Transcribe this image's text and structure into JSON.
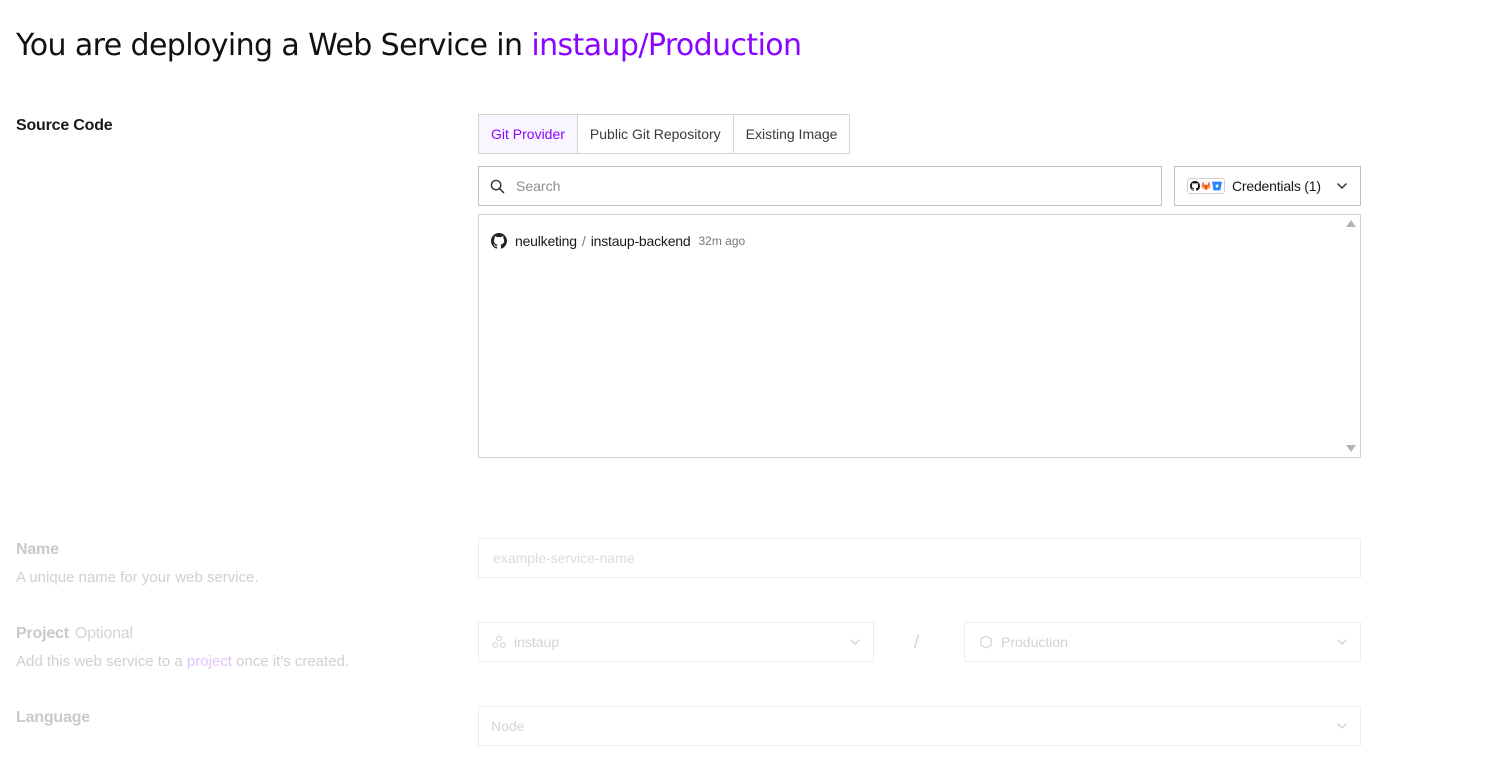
{
  "header": {
    "title_prefix": "You are deploying a Web Service in ",
    "title_workspace": "instaup/Production",
    "accent_color": "#8a05ff"
  },
  "source_code": {
    "label": "Source Code",
    "tabs": [
      {
        "label": "Git Provider",
        "active": true
      },
      {
        "label": "Public Git Repository",
        "active": false
      },
      {
        "label": "Existing Image",
        "active": false
      }
    ],
    "search": {
      "placeholder": "Search",
      "value": ""
    },
    "credentials": {
      "label": "Credentials (1)",
      "icons": [
        "github-icon",
        "gitlab-icon",
        "bitbucket-icon"
      ]
    },
    "repos": [
      {
        "owner": "neulketing",
        "separator": "/",
        "name": "instaup-backend",
        "updated": "32m ago",
        "icon": "github-icon"
      }
    ]
  },
  "name_field": {
    "label": "Name",
    "description": "A unique name for your web service.",
    "placeholder": "example-service-name"
  },
  "project_field": {
    "label": "Project",
    "optional": "Optional",
    "description_before": "Add this web service to a ",
    "description_link": "project",
    "description_after": " once it's created.",
    "project_value": "instaup",
    "separator": "/",
    "environment_value": "Production"
  },
  "language_field": {
    "label": "Language",
    "value": "Node"
  }
}
